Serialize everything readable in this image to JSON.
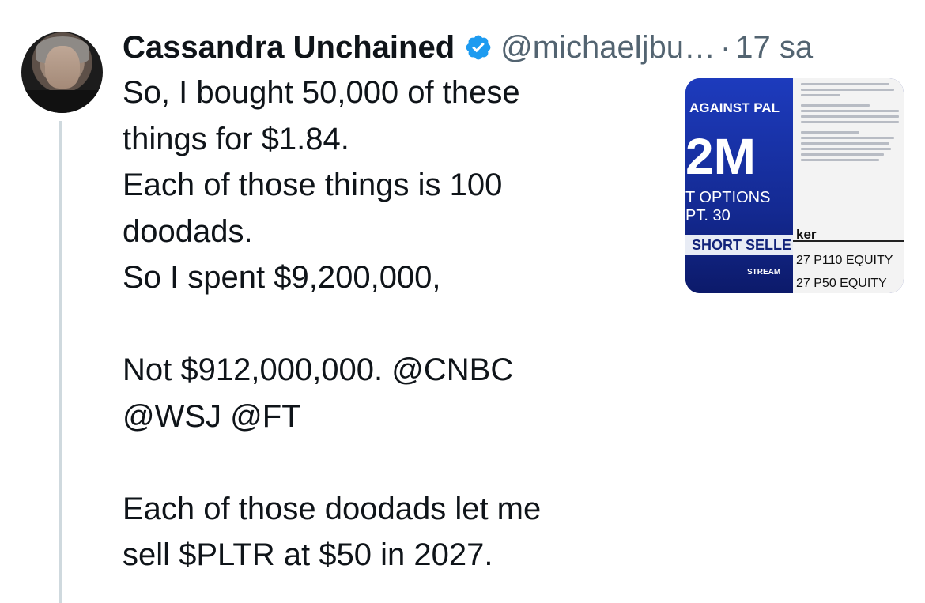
{
  "author": {
    "name": "Cassandra Unchained",
    "handle": "@michaeljbu…",
    "separator": "·",
    "time": "17 sa",
    "verified_icon": "verified-badge-icon",
    "accent_color": "#1d9bf0"
  },
  "tweet": {
    "text": "So, I bought 50,000 of these\nthings for $1.84.\nEach of those things is 100\ndoodads.\nSo I spent $9,200,000,\n\nNot $912,000,000. @CNBC\n@WSJ @FT\n\nEach of those doodads let me\nsell $PLTR at $50 in 2027."
  },
  "media": {
    "headline": "AGAINST PAL",
    "big_number": "2M",
    "options_line1": "T OPTIONS",
    "options_line2": "PT. 30",
    "short_seller": "SHORT SELLE",
    "stream": "STREAM",
    "ticker_label": "ker",
    "equity1": "27 P110 EQUITY",
    "equity2": "27 P50 EQUITY"
  }
}
